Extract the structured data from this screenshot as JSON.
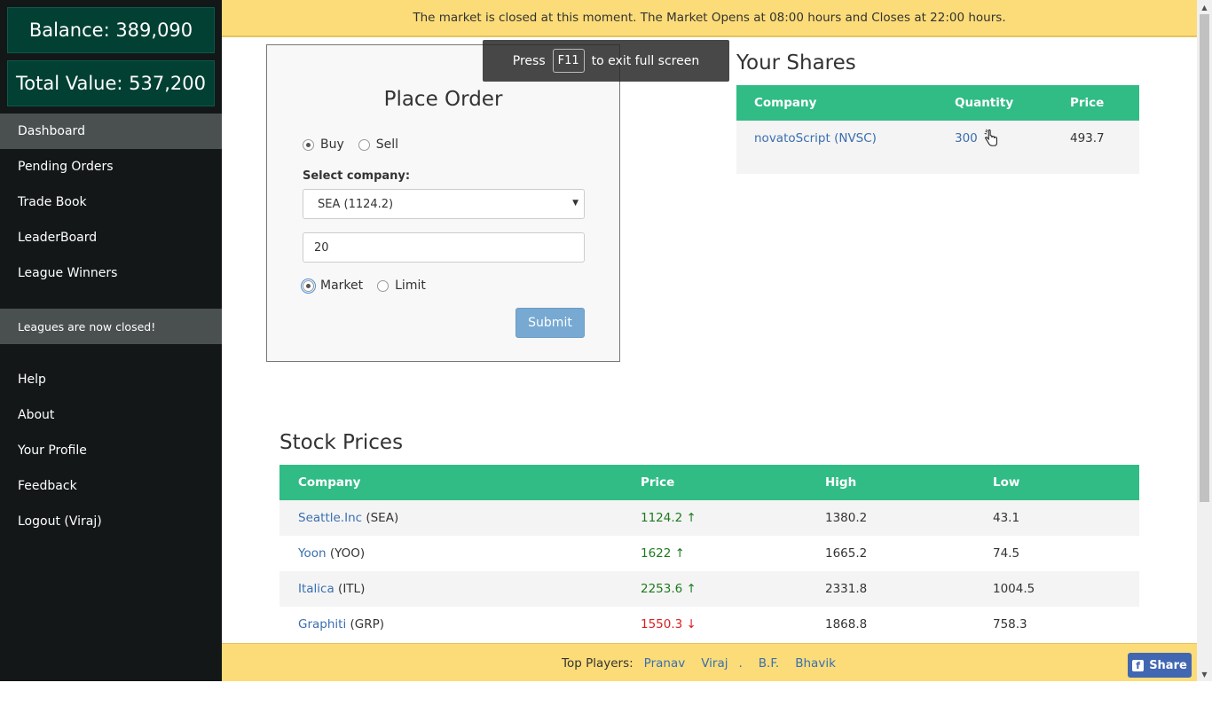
{
  "sidebar": {
    "balance": "Balance: 389,090",
    "total_value": "Total Value: 537,200",
    "nav": [
      {
        "label": "Dashboard"
      },
      {
        "label": "Pending Orders"
      },
      {
        "label": "Trade Book"
      },
      {
        "label": "LeaderBoard"
      },
      {
        "label": "League Winners"
      }
    ],
    "notice": "Leagues are now closed!",
    "nav2": [
      {
        "label": "Help"
      },
      {
        "label": "About"
      },
      {
        "label": "Your Profile"
      },
      {
        "label": "Feedback"
      },
      {
        "label": "Logout (Viraj)"
      }
    ]
  },
  "banner": {
    "text": "The market is closed at this moment. The Market Opens at 08:00 hours and Closes at 22:00 hours."
  },
  "fullscreen_tip": {
    "prefix": "Press",
    "key": "F11",
    "suffix": "to exit full screen"
  },
  "order": {
    "title": "Place Order",
    "side_options": [
      "Buy",
      "Sell"
    ],
    "side_selected": "Buy",
    "company_label": "Select company:",
    "company_selected": "SEA (1124.2)",
    "quantity": "20",
    "type_options": [
      "Market",
      "Limit"
    ],
    "type_selected": "Market",
    "submit_label": "Submit"
  },
  "shares": {
    "title": "Your Shares",
    "headers": [
      "Company",
      "Quantity",
      "Price"
    ],
    "rows": [
      {
        "company": "novatoScript (NVSC)",
        "quantity": "300",
        "price": "493.7"
      }
    ]
  },
  "prices": {
    "title": "Stock Prices",
    "headers": [
      "Company",
      "Price",
      "High",
      "Low"
    ],
    "rows": [
      {
        "name": "Seattle.Inc",
        "code": "(SEA)",
        "price": "1124.2 ↑",
        "high": "1380.2",
        "low": "43.1",
        "trend": "up"
      },
      {
        "name": "Yoon",
        "code": "(YOO)",
        "price": "1622 ↑",
        "high": "1665.2",
        "low": "74.5",
        "trend": "up"
      },
      {
        "name": "Italica",
        "code": "(ITL)",
        "price": "2253.6 ↑",
        "high": "2331.8",
        "low": "1004.5",
        "trend": "up"
      },
      {
        "name": "Graphiti",
        "code": "(GRP)",
        "price": "1550.3 ↓",
        "high": "1868.8",
        "low": "758.3",
        "trend": "down"
      }
    ]
  },
  "footer": {
    "label": "Top Players:",
    "players": [
      "Pranav",
      "Viraj",
      ".",
      "B.F.",
      "Bhavik"
    ],
    "share_label": "Share"
  },
  "colors": {
    "sidebar_bg": "#131718",
    "stat_box": "#024034",
    "banner": "#fcdc78",
    "table_header": "#31bc85",
    "submit": "#77a9d3",
    "link": "#3a6fb0",
    "up": "#1e7a1e",
    "down": "#d92020",
    "facebook": "#4267b2"
  }
}
